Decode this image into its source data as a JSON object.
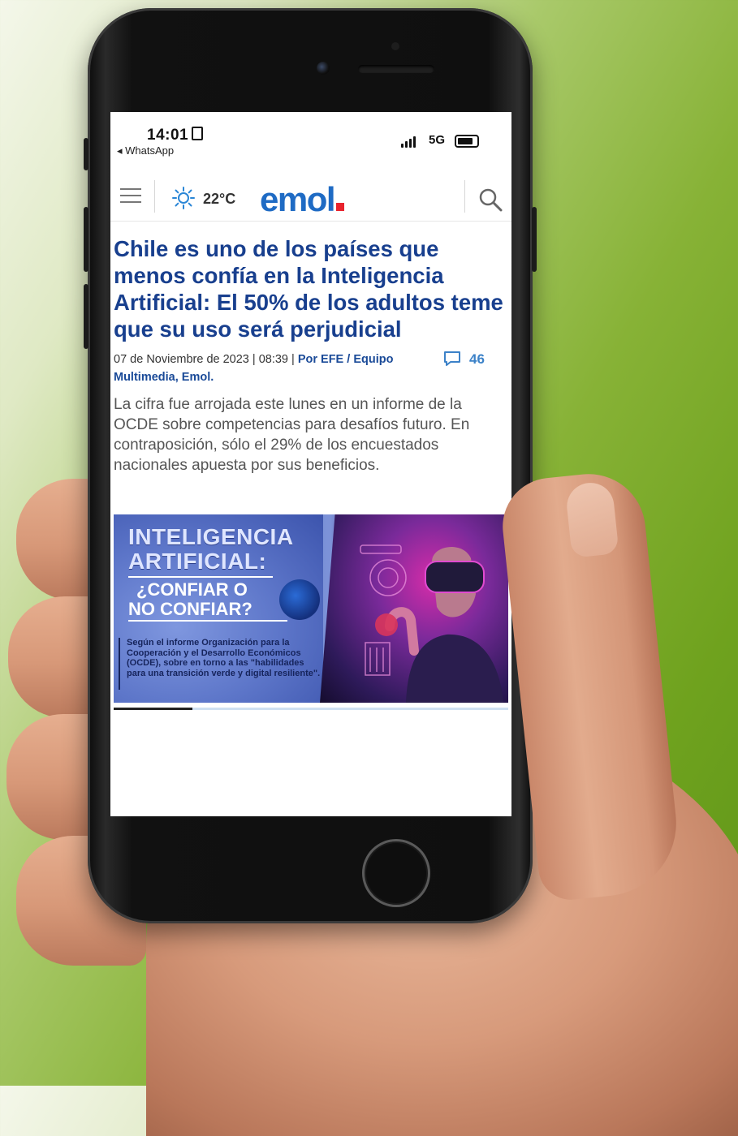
{
  "status_bar": {
    "time": "14:01",
    "back_app": "◂ WhatsApp",
    "network": "5G"
  },
  "nav": {
    "temperature": "22°C",
    "logo": "emol"
  },
  "article": {
    "headline": "Chile es uno de los países que menos confía en la Inteligencia Artificial: El 50% de los adultos teme que su uso será perjudicial",
    "date": "07 de Noviembre de 2023",
    "time": "08:39",
    "byline": "Por EFE / Equipo Multimedia, Emol.",
    "comment_count": "46",
    "lede": "La cifra fue arrojada este lunes en un informe de la OCDE sobre competencias para desafíos futuro. En contraposición, sólo el 29% de los encuestados nacionales apuesta por sus beneficios."
  },
  "banner": {
    "title_line1": "INTELIGENCIA",
    "title_line2": "ARTIFICIAL:",
    "question_line1": "¿CONFIAR O",
    "question_line2": "NO CONFIAR?",
    "note": "Según el informe Organización para la Cooperación y el Desarrollo Económicos (OCDE), sobre en torno a las \"habilidades para una transición verde y digital resiliente\"."
  },
  "colors": {
    "headline": "#183f8e",
    "logo_blue": "#1f6bc4",
    "logo_dot": "#e8232d",
    "comment_blue": "#3c82c8",
    "background_green": "#6fa21e"
  },
  "icons": {
    "menu": "hamburger-icon",
    "weather": "sun-icon",
    "search": "magnifier-icon",
    "comments": "speech-bubble-icon"
  },
  "progress": {
    "read_fraction": 0.2
  }
}
